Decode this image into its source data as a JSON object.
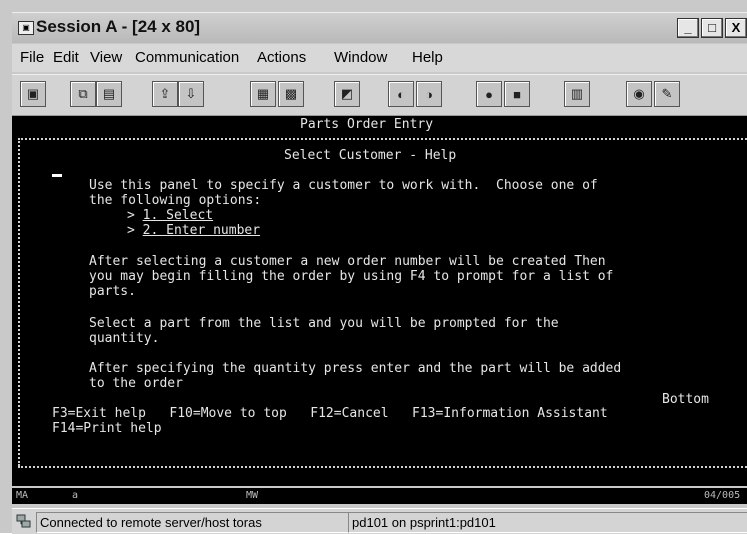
{
  "window": {
    "title": "Session A - [24 x 80]",
    "buttons": {
      "minimize": "_",
      "maximize": "□",
      "close": "X"
    }
  },
  "menu": [
    "File",
    "Edit",
    "View",
    "Communication",
    "Actions",
    "Window",
    "Help"
  ],
  "toolbar": [
    "print-screen-icon",
    "copy-icon",
    "paste-icon",
    "send-file-icon",
    "receive-file-icon",
    "display-setup-icon",
    "keyboard-icon",
    "macro-icon",
    "record-macro-icon",
    "play-macro-icon",
    "start-recording-icon",
    "stop-recording-icon",
    "clipboard-icon",
    "color-icon",
    "edit-icon"
  ],
  "terminal": {
    "header": "Parts Order Entry",
    "panel_title": "Select Customer - Help",
    "intro_1": "Use this panel to specify a customer to work with.  Choose one of",
    "intro_2": "the following options:",
    "option_1_prefix": "> ",
    "option_1": "1. Select",
    "option_2_prefix": "> ",
    "option_2": "2. Enter number",
    "para2_1": "After selecting a customer a new order number will be created Then",
    "para2_2": "you may begin filling the order by using F4 to prompt for a list of",
    "para2_3": "parts.",
    "para3_1": "Select a part from the list and you will be prompted for the",
    "para3_2": "quantity.",
    "para4_1": "After specifying the quantity press enter and the part will be added",
    "para4_2": "to the order",
    "bottom_label": "Bottom",
    "fkeys_1": "F3=Exit help   F10=Move to top   F12=Cancel   F13=Information Assistant",
    "fkeys_2": "F14=Print help"
  },
  "oia": {
    "left": "MA",
    "session": "a",
    "mode": "MW",
    "position": "04/005"
  },
  "status": {
    "connection": "Connected to remote server/host toras",
    "printer": "pd101 on psprint1:pd101"
  }
}
